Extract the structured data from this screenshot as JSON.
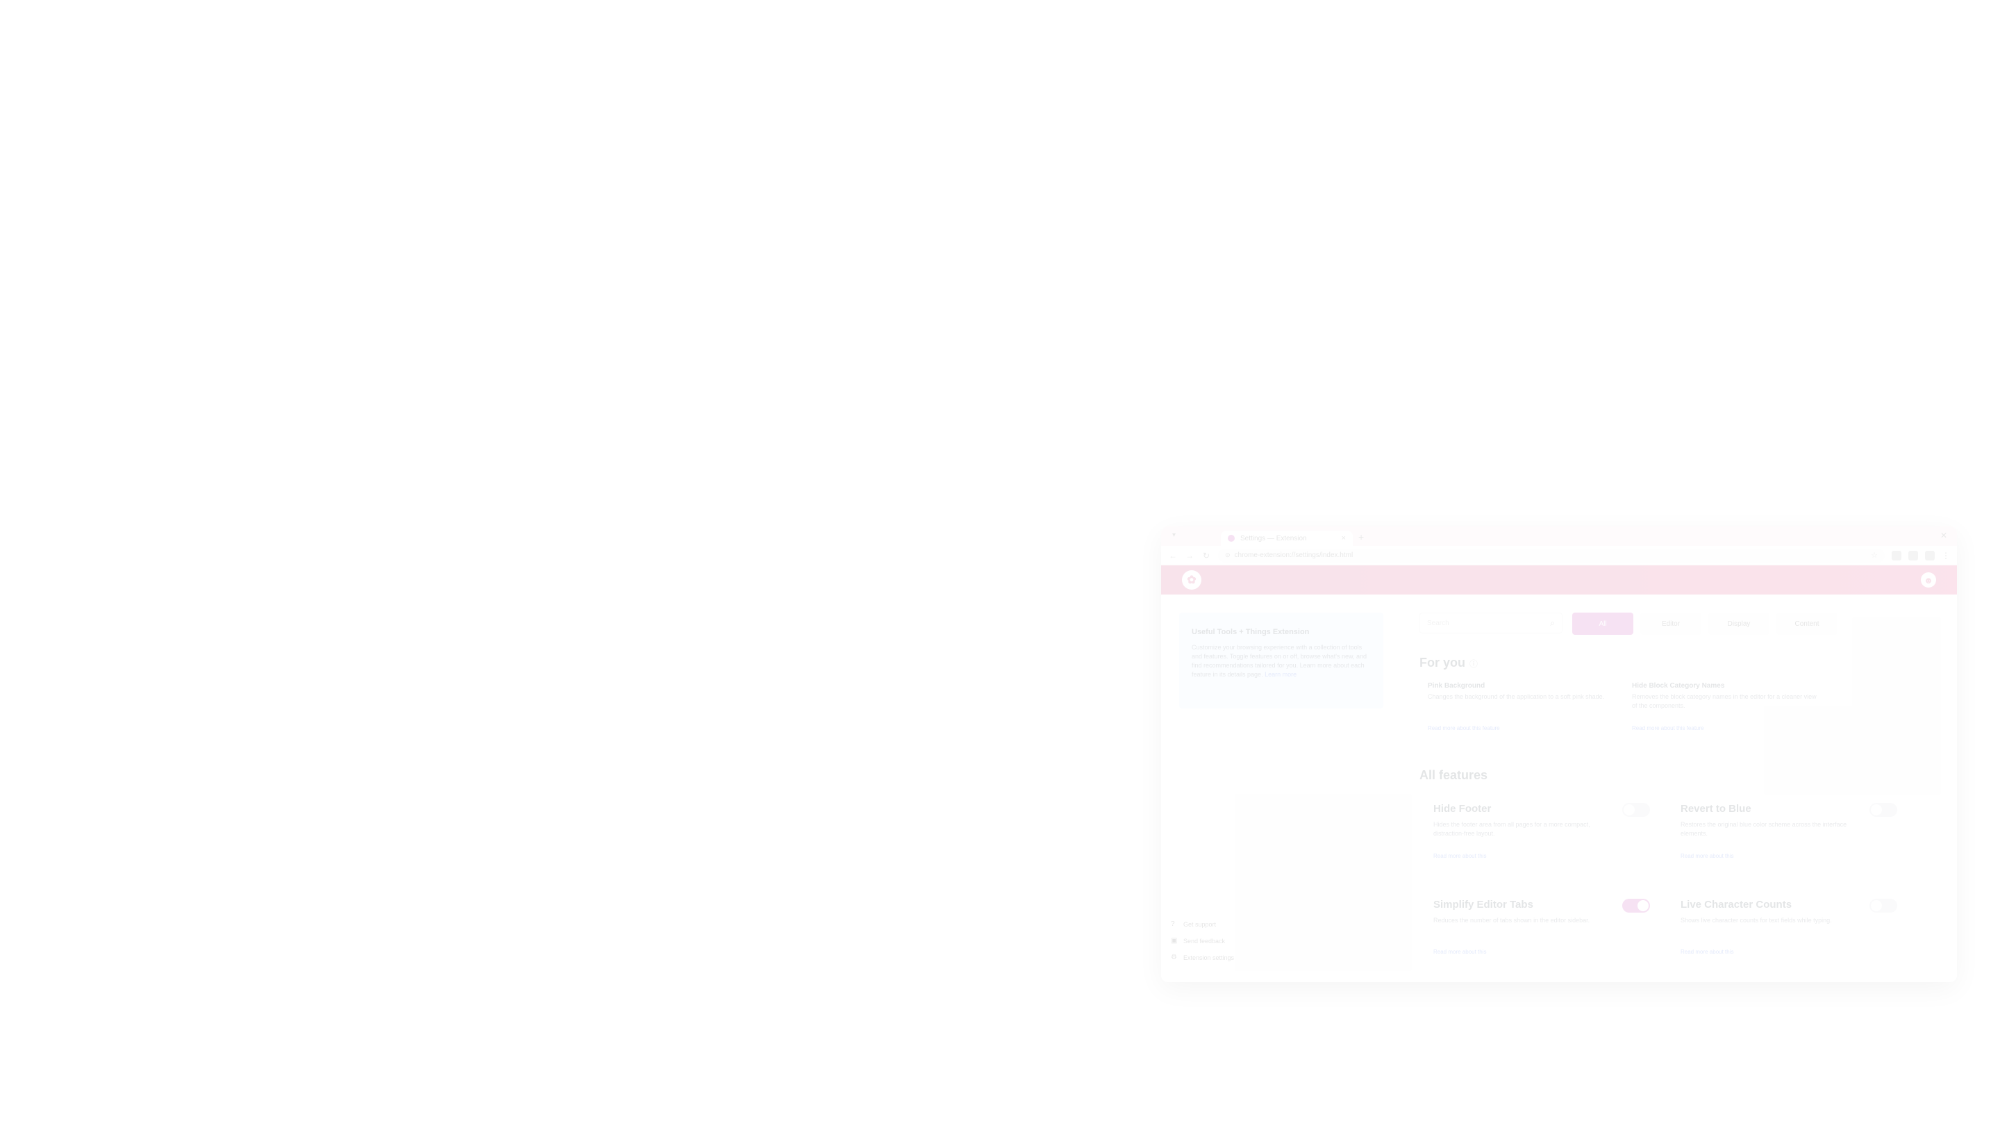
{
  "browser": {
    "tab_title": "Settings — Extension",
    "url": "chrome-extension://settings/index.html"
  },
  "header": {
    "logo_glyph": "✿",
    "profile_glyph": "☻"
  },
  "info_card": {
    "title": "Useful Tools + Things Extension",
    "body": "Customize your browsing experience with a collection of tools and features. Toggle features on or off, browse what's new, and find recommendations tailored for you. Learn more about each feature in its details page.",
    "link": "Learn more"
  },
  "sidebar_links": [
    {
      "label": "Get support",
      "icon": "help-icon",
      "glyph": "?"
    },
    {
      "label": "Send feedback",
      "icon": "feedback-icon",
      "glyph": "▣"
    },
    {
      "label": "Extension settings",
      "icon": "gear-icon",
      "glyph": "⚙"
    }
  ],
  "search": {
    "placeholder": "Search"
  },
  "filters": [
    {
      "label": "All",
      "active": true
    },
    {
      "label": "Editor"
    },
    {
      "label": "Display"
    },
    {
      "label": "Content"
    }
  ],
  "for_you": {
    "title": "For you",
    "cards": [
      {
        "title": "Pink Background",
        "desc": "Changes the background of the application to a soft pink shade.",
        "link": "Read more about this feature"
      },
      {
        "title": "Hide Block Category Names",
        "desc": "Removes the block category names in the editor for a cleaner view of the components.",
        "link": "Read more about this feature"
      }
    ]
  },
  "all_features": {
    "title": "All features",
    "items": [
      {
        "title": "Hide Footer",
        "desc": "Hides the footer area from all pages for a more compact, distraction-free layout.",
        "link": "Read more about this",
        "on": false
      },
      {
        "title": "Revert to Blue",
        "desc": "Restores the original blue color scheme across the interface elements.",
        "link": "Read more about this",
        "on": false
      },
      {
        "title": "Simplify Editor Tabs",
        "desc": "Reduces the number of tabs shown in the editor sidebar.",
        "link": "Read more about this",
        "on": true
      },
      {
        "title": "Live Character Counts",
        "desc": "Shows live character counts for text fields while typing.",
        "link": "Read more about this",
        "on": false
      }
    ]
  }
}
